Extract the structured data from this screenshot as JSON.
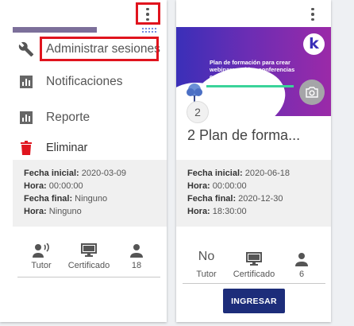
{
  "left_card": {
    "menu": {
      "items": [
        {
          "label": "Administrar sesiones",
          "icon": "wrench-icon"
        },
        {
          "label": "Notificaciones",
          "icon": "bar-chart-icon"
        },
        {
          "label": "Reporte",
          "icon": "bar-chart-icon"
        },
        {
          "label": "Eliminar",
          "icon": "trash-icon"
        }
      ]
    },
    "info": {
      "fecha_inicial_label": "Fecha inicial:",
      "fecha_inicial_value": " 2020-03-09",
      "hora1_label": "Hora:",
      "hora1_value": " 00:00:00",
      "fecha_final_label": "Fecha final:",
      "fecha_final_value": " Ninguno",
      "hora2_label": "Hora:",
      "hora2_value": " Ninguno"
    },
    "stats": [
      {
        "label": "Tutor",
        "icon": "person-voice-icon"
      },
      {
        "label": "Certificado",
        "icon": "monitor-icon"
      },
      {
        "label": "18",
        "icon": "person-icon"
      }
    ]
  },
  "right_card": {
    "banner": {
      "text": "Plan de formación para crear webinars y video conferencias con éxito en kme360",
      "logo_letter": "k"
    },
    "badge": "2",
    "title": "2 Plan de forma...",
    "info": {
      "fecha_inicial_label": "Fecha inicial:",
      "fecha_inicial_value": " 2020-06-18",
      "hora1_label": "Hora:",
      "hora1_value": " 00:00:00",
      "fecha_final_label": "Fecha final:",
      "fecha_final_value": " 2020-12-30",
      "hora2_label": "Hora:",
      "hora2_value": " 18:30:00"
    },
    "stats": [
      {
        "value": "No",
        "label": "Tutor"
      },
      {
        "label": "Certificado",
        "icon": "monitor-icon"
      },
      {
        "label": "6",
        "icon": "person-icon"
      }
    ],
    "button_label": "INGRESAR"
  },
  "colors": {
    "highlight": "#e0141e",
    "button": "#1d2d7a",
    "delete": "#e0141e",
    "banner_start": "#3a2fb8",
    "banner_end": "#9b2aa8"
  }
}
